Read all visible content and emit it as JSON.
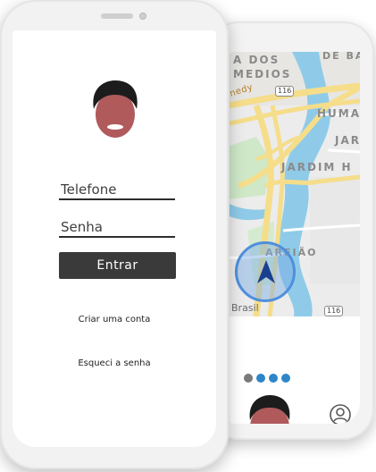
{
  "map_screen": {
    "labels": {
      "midios_line1": "A DOS",
      "midios_line2": "MEDIOS",
      "debai": "DE BA",
      "road": "nedy",
      "humai": "HUMA",
      "jar": "JAR",
      "jardim": "JARDIM H",
      "areiao": "AREIÃO",
      "brasil": "Brasil"
    },
    "route_shields": [
      "116",
      "116"
    ],
    "pager_dots": [
      {
        "color": "#7a7a7a"
      },
      {
        "color": "#2e86c8"
      },
      {
        "color": "#2e86c8"
      },
      {
        "color": "#2e86c8"
      }
    ]
  },
  "login": {
    "phone_placeholder": "Telefone",
    "password_placeholder": "Senha",
    "enter_label": "Entrar",
    "create_account_label": "Criar uma conta",
    "forgot_password_label": "Esqueci a senha"
  },
  "colors": {
    "button": "#3a3a3a",
    "accent_blue": "#2e86c8",
    "map_road": "#f5dd8a",
    "map_water": "#8fcbe8"
  }
}
